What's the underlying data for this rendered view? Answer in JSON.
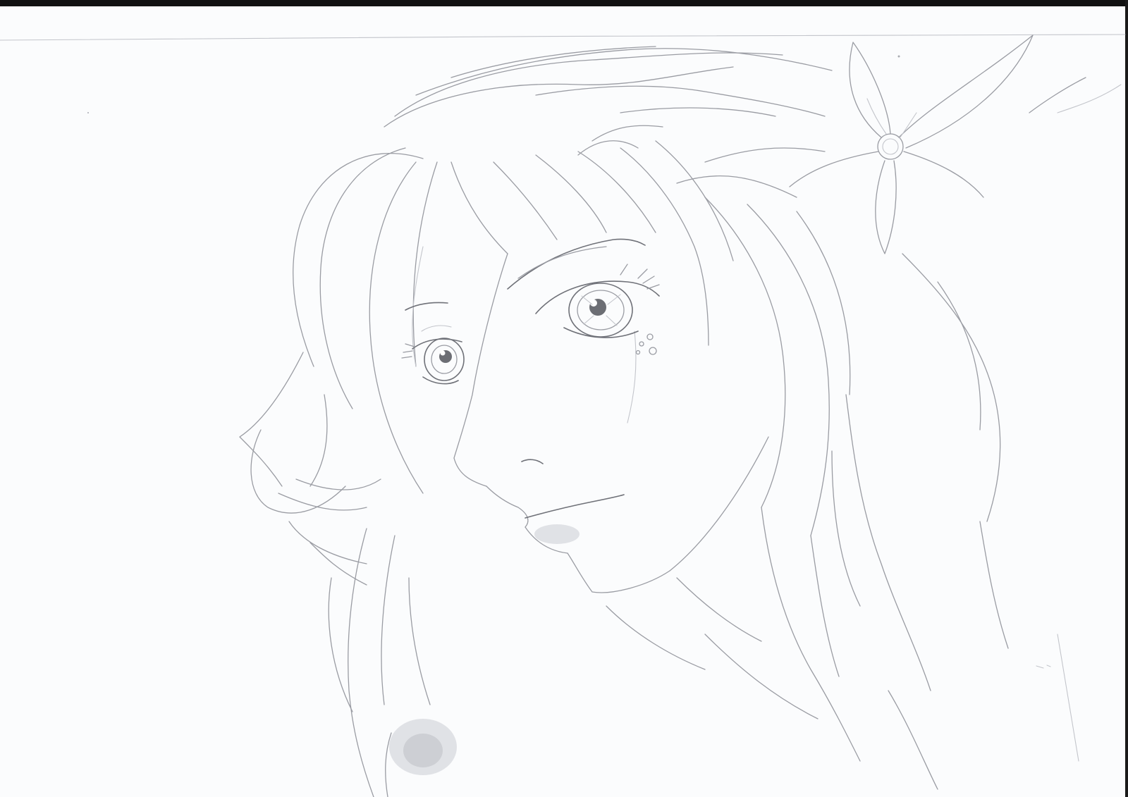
{
  "image": {
    "subject": "pencil-sketch-portrait",
    "colors": {
      "paper": "#fbfcfd",
      "pencil": "#9a9ca3",
      "pencil_dark": "#6f7178",
      "scanner_edge": "#111111"
    }
  }
}
